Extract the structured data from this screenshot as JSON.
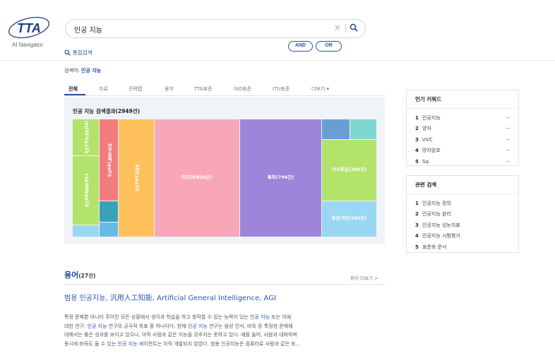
{
  "brand": {
    "logo_text": "TTA",
    "sub_title": "AI Navigator",
    "logo_color": "#1e3e8a"
  },
  "search": {
    "value": "인공 지능",
    "clear_icon": "×",
    "and_label": "AND",
    "or_label": "OR",
    "total_search_label": "통합검색"
  },
  "query": {
    "prefix": "검색어: ",
    "term": "인공 지능"
  },
  "tabs": [
    {
      "label": "전체",
      "active": true
    },
    {
      "label": "자료"
    },
    {
      "label": "전략맵"
    },
    {
      "label": "용어"
    },
    {
      "label": "TTA표준"
    },
    {
      "label": "ISO표준"
    },
    {
      "label": "ITU표준"
    },
    {
      "label": "더보기 ▾"
    }
  ],
  "treemap": {
    "title": "인공 지능 검색결과(2949건)",
    "cells": [
      {
        "label": "ITU권고(61건)",
        "color": "#b3e36b"
      },
      {
        "label": "TTA표준(99건)",
        "color": "#b3e36b"
      },
      {
        "label": "",
        "color": "#9ad7f2"
      },
      {
        "label": "연구용역(89건)",
        "color": "#f27b7b"
      },
      {
        "label": "",
        "color": "#3aa1b8"
      },
      {
        "label": "",
        "color": "#6ab8e6"
      },
      {
        "label": "논문(341건)",
        "color": "#fdc05a"
      },
      {
        "label": "미디어(830건)",
        "color": "#f8a7b9"
      },
      {
        "label": "특허(794건)",
        "color": "#9d85d9"
      },
      {
        "label": "",
        "color": "#6a9fd3"
      },
      {
        "label": "",
        "color": "#7fd8cf"
      },
      {
        "label": "ITU표준(280건)",
        "color": "#b3e36b"
      },
      {
        "label": "표준기타(165건)",
        "color": "#9ad7f2"
      }
    ]
  },
  "popular": {
    "title": "인기 키워드",
    "items": [
      {
        "rank": "1",
        "keyword": "인공지능",
        "trend": "--"
      },
      {
        "rank": "2",
        "keyword": "양자",
        "trend": "--"
      },
      {
        "rank": "3",
        "keyword": "VVC",
        "trend": "--"
      },
      {
        "rank": "4",
        "keyword": "양자암호",
        "trend": "--"
      },
      {
        "rank": "5",
        "keyword": "Sq",
        "trend": "--"
      }
    ]
  },
  "related": {
    "title": "관련 검색",
    "items": [
      {
        "rank": "1",
        "keyword": "인공지능 정의"
      },
      {
        "rank": "2",
        "keyword": "인공지능 윤리"
      },
      {
        "rank": "3",
        "keyword": "인공지능 성능지표"
      },
      {
        "rank": "4",
        "keyword": "인공지능 시험평가"
      },
      {
        "rank": "5",
        "keyword": "표준화 문서"
      }
    ]
  },
  "terms": {
    "title": "용어",
    "count": "(27건)",
    "more_label": "용어 더보기 >",
    "heading": "범용 인공지능, 汎用人工知能, Artificial General Intelligence, AGI",
    "desc": [
      [
        "특정 문제뿐 아니라 주어진 모든 상황에서 생각과 학습을 하고 창작할 수 있는 능력이 있는 ",
        "인공 지능",
        " 또는 이에"
      ],
      [
        "대한 연구. ",
        "인공 지능",
        " 연구의 궁극적 목표 중 하나이다. 현재 ",
        "인공 지능",
        " 연구는 음성 인식, 바둑 등 특정한 문제에"
      ],
      [
        "대해서는 좋은 성과를 보이고 있으나, 아직 사람과 같은 지능을 갖추지는 못하고 있다. 예를 들어, 사람과 대화하며"
      ],
      [
        "동시에 바둑도 둘 수 있는 ",
        "인공 지능",
        " 에이전트는 아직 개발되지 않았다. 범용 인공지능은 컴퓨터로 사람과 같은 또..."
      ]
    ]
  }
}
